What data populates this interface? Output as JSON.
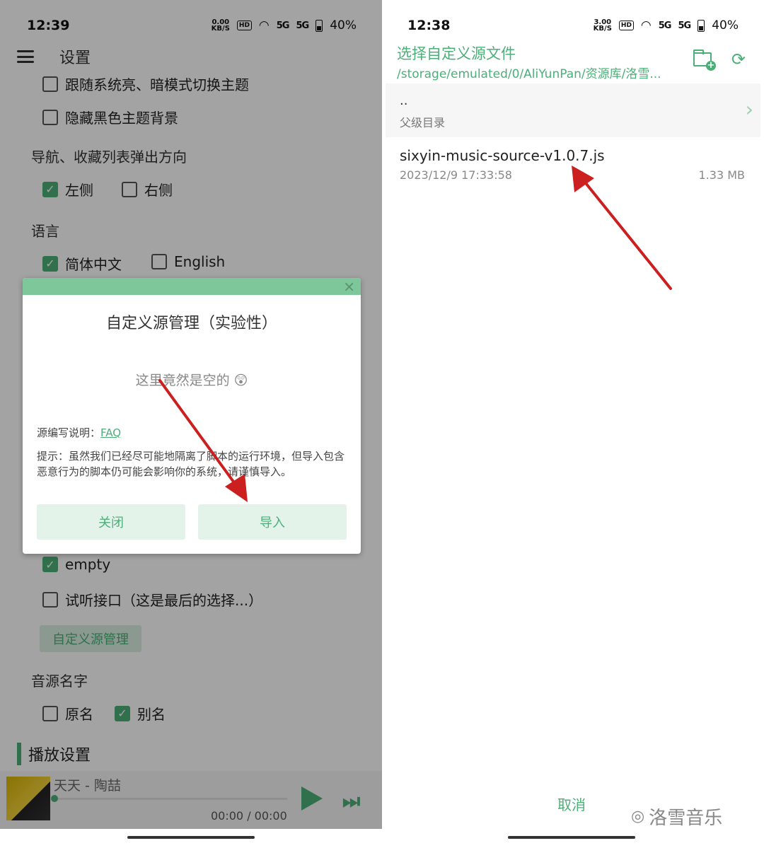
{
  "left": {
    "status": {
      "time": "12:39",
      "speed_top": "0.00",
      "speed_unit": "KB/S",
      "hd": "HD",
      "sig1": "5G",
      "sig2": "5G",
      "battery": "40%"
    },
    "header": {
      "title": "设置"
    },
    "opt_follow_theme": "跟随系统亮、暗模式切换主题",
    "opt_hide_black": "隐藏黑色主题背景",
    "nav_direction": {
      "label": "导航、收藏列表弹出方向",
      "left": "左侧",
      "right": "右侧"
    },
    "language": {
      "label": "语言",
      "zh": "简体中文",
      "en": "English"
    },
    "source_empty": "empty",
    "source_trial": "试听接口（这是最后的选择...）",
    "custom_source_btn": "自定义源管理",
    "source_name": {
      "label": "音源名字",
      "original": "原名",
      "alias": "别名"
    },
    "play_settings": "播放设置",
    "player": {
      "song": "天天 - 陶喆",
      "time": "00:00 / 00:00",
      "next_icon": "⏭"
    },
    "modal": {
      "close_x": "×",
      "title": "自定义源管理（实验性）",
      "empty": "这里竟然是空的 😲",
      "help_prefix": "源编写说明：",
      "help_link": "FAQ",
      "tip": "提示：虽然我们已经尽可能地隔离了脚本的运行环境，但导入包含恶意行为的脚本仍可能会影响你的系统，请谨慎导入。",
      "close_btn": "关闭",
      "import_btn": "导入"
    }
  },
  "right": {
    "status": {
      "time": "12:38",
      "speed_top": "3.00",
      "speed_unit": "KB/S",
      "hd": "HD",
      "sig1": "5G",
      "sig2": "5G",
      "battery": "40%"
    },
    "title": "选择自定义源文件",
    "path": "/storage/emulated/0/AliYunPan/资源库/洛雪...",
    "parent": {
      "dots": "..",
      "label": "父级目录"
    },
    "file": {
      "name": "sixyin-music-source-v1.0.7.js",
      "date": "2023/12/9 17:33:58",
      "size": "1.33 MB"
    },
    "cancel": "取消",
    "watermark": "洛雪音乐"
  },
  "colors": {
    "accent": "#4caf78",
    "arrow": "#cc1f1f"
  }
}
